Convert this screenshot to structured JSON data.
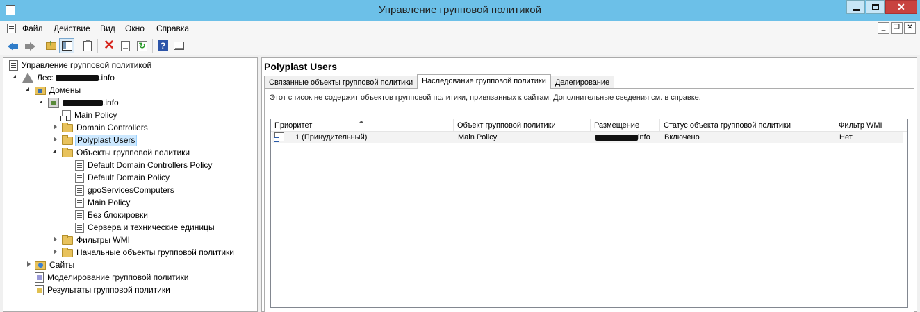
{
  "window": {
    "title": "Управление групповой политикой"
  },
  "menu": [
    "Файл",
    "Действие",
    "Вид",
    "Окно",
    "Справка"
  ],
  "tree": {
    "root": "Управление групповой политикой",
    "forest_prefix": "Лес: ",
    "forest_suffix": ".info",
    "domains": "Домены",
    "domain_suffix": ".info",
    "main_policy": "Main Policy",
    "domain_controllers": "Domain Controllers",
    "polyplast_users": "Polyplast Users",
    "gpo_folder": "Объекты групповой политики",
    "gpos": [
      "Default Domain Controllers Policy",
      "Default Domain Policy",
      "gpoServicesComputers",
      "Main Policy",
      "Без блокировки",
      "Сервера и технические единицы"
    ],
    "wmi_filters": "Фильтры WMI",
    "starter_gpos": "Начальные объекты групповой политики",
    "sites": "Сайты",
    "modeling": "Моделирование групповой политики",
    "results": "Результаты групповой политики"
  },
  "details": {
    "title": "Polyplast Users",
    "tabs": [
      "Связанные объекты групповой политики",
      "Наследование групповой политики",
      "Делегирование"
    ],
    "active_tab": 1,
    "info": "Этот список не содержит объектов групповой политики, привязанных к сайтам. Дополнительные сведения см. в справке.",
    "columns": [
      "Приоритет",
      "Объект групповой политики",
      "Размещение",
      "Статус объекта групповой политики",
      "Фильтр WMI"
    ],
    "rows": [
      {
        "priority": "1 (Принудительный)",
        "gpo": "Main Policy",
        "location_suffix": "info",
        "status": "Включено",
        "wmi": "Нет"
      }
    ]
  }
}
